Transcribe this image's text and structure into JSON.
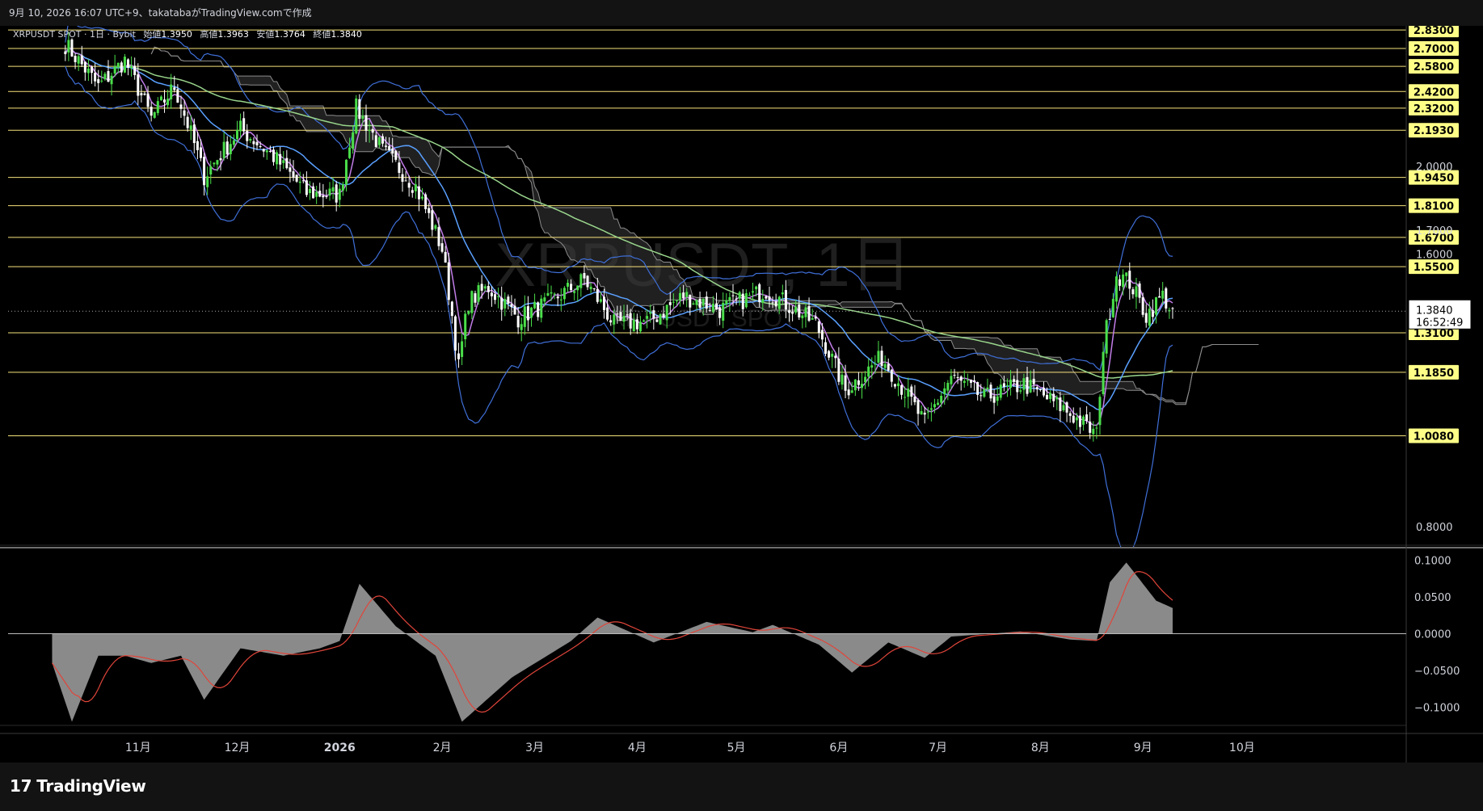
{
  "header": {
    "snapshot_line": "9月 10, 2026 16:07 UTC+9、takatabaがTradingView.comで作成"
  },
  "legend": {
    "symbol": "XRPUSDT SPOT · 1日 · Bybit",
    "open_label": "始値",
    "open": "1.3950",
    "high_label": "高値",
    "high": "1.3963",
    "low_label": "安値",
    "low": "1.3764",
    "close_label": "終値",
    "close": "1.3840"
  },
  "watermark": {
    "title": "XRPUSDT, 1日",
    "subtitle": "XRPUSDT SPOT"
  },
  "footer": {
    "brand": "TradingView"
  },
  "colors": {
    "background": "#000000",
    "panel": "#131313",
    "candle_up": "#4ade4a",
    "candle_down": "#ffffff",
    "level_line": "#f5e27a",
    "level_tag": "#ffff88",
    "bollinger": "#3f6fd8",
    "ma_short": "#c27de8",
    "ma_mid": "#5aa0ff",
    "ma_long": "#9ad68c",
    "macd_fill": "#8a8a8a",
    "macd_signal": "#e0453a"
  },
  "chart_data": [
    {
      "type": "candlestick",
      "title": "XRPUSDT, 1日",
      "x_ticks": [
        "11月",
        "12月",
        "2026",
        "2月",
        "3月",
        "4月",
        "5月",
        "6月",
        "7月",
        "8月",
        "9月",
        "10月"
      ],
      "y_scale": "log",
      "ylim": [
        0.76,
        2.86
      ],
      "y_tick_labels": [
        "2.0000",
        "1.7000",
        "1.6000",
        "0.8000"
      ],
      "levels": [
        "2.8300",
        "2.7000",
        "2.5800",
        "2.4200",
        "2.3200",
        "2.1930",
        "1.9450",
        "1.8100",
        "1.6700",
        "1.5500",
        "1.3100",
        "1.1850",
        "1.0080"
      ],
      "current_price": "1.3840",
      "countdown": "16:52:49",
      "anchors_close": [
        {
          "date": "2025-10-10",
          "value": 2.73
        },
        {
          "date": "2025-10-20",
          "value": 2.45
        },
        {
          "date": "2025-10-28",
          "value": 2.62
        },
        {
          "date": "2025-11-05",
          "value": 2.26
        },
        {
          "date": "2025-11-12",
          "value": 2.45
        },
        {
          "date": "2025-11-21",
          "value": 1.95
        },
        {
          "date": "2025-12-02",
          "value": 2.2
        },
        {
          "date": "2025-12-12",
          "value": 2.05
        },
        {
          "date": "2025-12-22",
          "value": 1.87
        },
        {
          "date": "2026-01-01",
          "value": 1.86
        },
        {
          "date": "2026-01-06",
          "value": 2.32
        },
        {
          "date": "2026-01-14",
          "value": 2.08
        },
        {
          "date": "2026-01-24",
          "value": 1.9
        },
        {
          "date": "2026-02-01",
          "value": 1.62
        },
        {
          "date": "2026-02-06",
          "value": 1.2
        },
        {
          "date": "2026-02-09",
          "value": 1.42
        },
        {
          "date": "2026-02-15",
          "value": 1.47
        },
        {
          "date": "2026-02-24",
          "value": 1.36
        },
        {
          "date": "2026-03-06",
          "value": 1.42
        },
        {
          "date": "2026-03-16",
          "value": 1.5
        },
        {
          "date": "2026-03-25",
          "value": 1.34
        },
        {
          "date": "2026-04-05",
          "value": 1.35
        },
        {
          "date": "2026-04-15",
          "value": 1.44
        },
        {
          "date": "2026-04-26",
          "value": 1.39
        },
        {
          "date": "2026-05-10",
          "value": 1.46
        },
        {
          "date": "2026-05-25",
          "value": 1.34
        },
        {
          "date": "2026-06-03",
          "value": 1.13
        },
        {
          "date": "2026-06-14",
          "value": 1.23
        },
        {
          "date": "2026-06-27",
          "value": 1.04
        },
        {
          "date": "2026-07-05",
          "value": 1.17
        },
        {
          "date": "2026-07-15",
          "value": 1.11
        },
        {
          "date": "2026-07-27",
          "value": 1.15
        },
        {
          "date": "2026-08-08",
          "value": 1.08
        },
        {
          "date": "2026-08-18",
          "value": 1.01
        },
        {
          "date": "2026-08-20",
          "value": 1.26
        },
        {
          "date": "2026-08-24",
          "value": 1.52
        },
        {
          "date": "2026-08-28",
          "value": 1.49
        },
        {
          "date": "2026-09-02",
          "value": 1.37
        },
        {
          "date": "2026-09-07",
          "value": 1.44
        },
        {
          "date": "2026-09-10",
          "value": 1.38
        }
      ]
    },
    {
      "type": "area",
      "y_tick_labels": [
        "0.1000",
        "0.0500",
        "0.0000",
        "−0.0500",
        "−0.1000"
      ],
      "ylim": [
        -0.125,
        0.115
      ],
      "macd": [
        {
          "date": "2025-10-06",
          "value": -0.04
        },
        {
          "date": "2025-10-12",
          "value": -0.12
        },
        {
          "date": "2025-10-20",
          "value": -0.03
        },
        {
          "date": "2025-10-28",
          "value": -0.03
        },
        {
          "date": "2025-11-05",
          "value": -0.04
        },
        {
          "date": "2025-11-14",
          "value": -0.03
        },
        {
          "date": "2025-11-21",
          "value": -0.09
        },
        {
          "date": "2025-12-02",
          "value": -0.02
        },
        {
          "date": "2025-12-15",
          "value": -0.03
        },
        {
          "date": "2025-12-26",
          "value": -0.02
        },
        {
          "date": "2026-01-01",
          "value": -0.01
        },
        {
          "date": "2026-01-07",
          "value": 0.068
        },
        {
          "date": "2026-01-18",
          "value": 0.01
        },
        {
          "date": "2026-01-30",
          "value": -0.03
        },
        {
          "date": "2026-02-07",
          "value": -0.12
        },
        {
          "date": "2026-02-22",
          "value": -0.06
        },
        {
          "date": "2026-03-12",
          "value": -0.01
        },
        {
          "date": "2026-03-20",
          "value": 0.022
        },
        {
          "date": "2026-04-06",
          "value": -0.012
        },
        {
          "date": "2026-04-22",
          "value": 0.016
        },
        {
          "date": "2026-05-06",
          "value": 0.002
        },
        {
          "date": "2026-05-12",
          "value": 0.012
        },
        {
          "date": "2026-05-26",
          "value": -0.015
        },
        {
          "date": "2026-06-05",
          "value": -0.053
        },
        {
          "date": "2026-06-16",
          "value": -0.012
        },
        {
          "date": "2026-06-27",
          "value": -0.033
        },
        {
          "date": "2026-07-05",
          "value": -0.004
        },
        {
          "date": "2026-07-26",
          "value": 0.003
        },
        {
          "date": "2026-08-10",
          "value": -0.008
        },
        {
          "date": "2026-08-18",
          "value": -0.01
        },
        {
          "date": "2026-08-22",
          "value": 0.07
        },
        {
          "date": "2026-08-27",
          "value": 0.097
        },
        {
          "date": "2026-09-05",
          "value": 0.045
        },
        {
          "date": "2026-09-10",
          "value": 0.035
        }
      ]
    }
  ]
}
